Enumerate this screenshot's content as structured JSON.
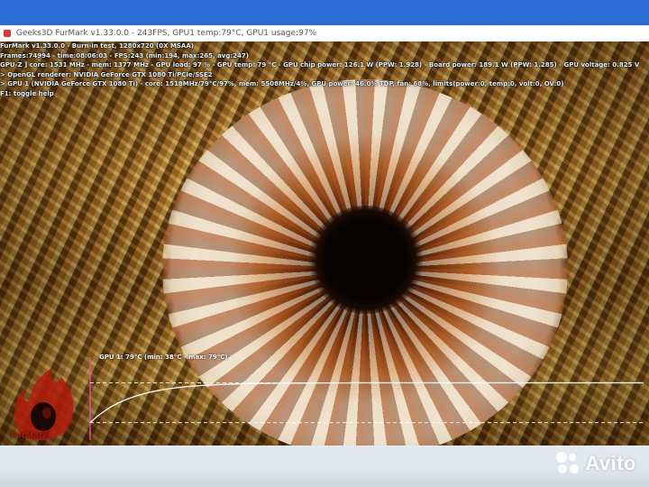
{
  "window": {
    "title": "Geeks3D FurMark v1.33.0.0 - 243FPS, GPU1 temp:79°C, GPU1 usage:97%"
  },
  "overlay": {
    "lines": [
      "FurMark v1.33.0.0 - Burn-in test, 1280x720 (0X MSAA)",
      "Frames:74994 - time:08:06:03 - FPS:243 (min:194, max:265, avg:247)",
      "GPU-Z ] core: 1531 MHz - mem: 1377 MHz - GPU load: 97 % - GPU temp: 79 °C - GPU chip power: 126.1 W (PPW: 1.928) - Board power: 189.1 W (PPW: 1.285) - GPU voltage: 0.825 V",
      "> OpenGL renderer: NVIDIA GeForce GTX 1080 Ti/PCIe/SSE2",
      "> GPU 1 (NVIDIA GeForce GTX 1080 Ti) - core: 1518MHz/79°C/97%, mem: 5508MHz/4%, GPU power: 46.0% TDP, fan: 68%, limits(power:0, temp:0, volt:0, OV:0)",
      "F1: toggle help"
    ]
  },
  "graph": {
    "label": "GPU 1: 79°C (min: 38°C - max: 79°C)",
    "min_temp": 38,
    "max_temp": 79,
    "current_temp": 79,
    "line_color": "#ffffff",
    "axis_color": "#e05090"
  },
  "logo": {
    "text": "FurMark",
    "color": "#b01a0a"
  },
  "watermark": {
    "text": "Avito"
  }
}
